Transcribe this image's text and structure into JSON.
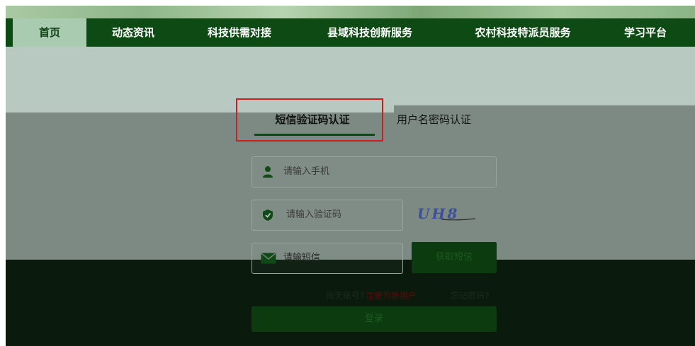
{
  "nav": {
    "items": [
      {
        "label": "首页",
        "active": true
      },
      {
        "label": "动态资讯"
      },
      {
        "label": "科技供需对接"
      },
      {
        "label": "县域科技创新服务"
      },
      {
        "label": "农村科技特派员服务"
      },
      {
        "label": "学习平台"
      }
    ]
  },
  "tabs": {
    "sms": "短信验证码认证",
    "user": "用户名密码认证"
  },
  "form": {
    "phone_placeholder": "请输入手机",
    "code_placeholder": "请输入验证码",
    "sms_placeholder": "请输短信",
    "captcha_text": "UH8",
    "get_sms_label": "获取短信",
    "register_prefix": "尚无账号?",
    "register_link": "注册为新用户",
    "forgot_link": "忘记密码?",
    "login_label": "登录"
  },
  "colors": {
    "nav_bg": "#0e4a14",
    "nav_active_bg": "#a9cbb0",
    "highlight_border": "#d11c1c",
    "tab_underline": "#0e4a14"
  },
  "icons": {
    "phone_field": "user-icon",
    "code_field": "shield-icon",
    "sms_field": "mail-icon"
  }
}
